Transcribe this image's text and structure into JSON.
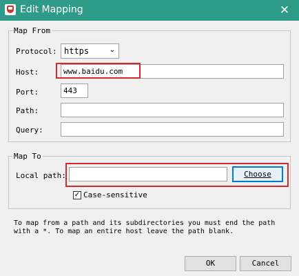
{
  "window": {
    "title": "Edit Mapping",
    "close_glyph": "✕"
  },
  "map_from": {
    "legend": "Map From",
    "protocol_label": "Protocol:",
    "protocol_value": "https",
    "protocol_arrow": "⌄",
    "host_label": "Host:",
    "host_value": "www.baidu.com",
    "port_label": "Port:",
    "port_value": "443",
    "path_label": "Path:",
    "path_value": "",
    "query_label": "Query:",
    "query_value": ""
  },
  "map_to": {
    "legend": "Map To",
    "local_path_label": "Local path:",
    "local_path_value": "",
    "choose_label": "Choose",
    "case_sensitive_label": "Case-sensitive",
    "case_sensitive_checked": true,
    "check_glyph": "✓"
  },
  "note": "To map from a path and its subdirectories you must end the path\nwith a *. To map an entire host leave the path blank.",
  "footer": {
    "ok_label": "OK",
    "cancel_label": "Cancel"
  },
  "colors": {
    "titlebar": "#2d9b87",
    "highlight": "#d62828",
    "focus": "#0078d7"
  }
}
